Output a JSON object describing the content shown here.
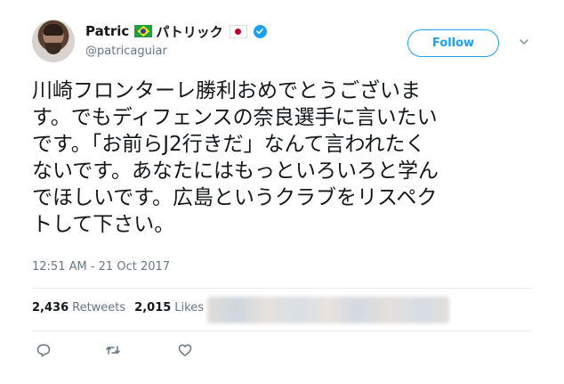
{
  "user": {
    "display_name": "Patric",
    "display_name_jp": "パトリック",
    "handle": "@patricaguiar",
    "flags": [
      "brazil-flag",
      "japan-flag"
    ],
    "verified": true
  },
  "follow_button": {
    "label": "Follow"
  },
  "tweet": {
    "lines": [
      "川崎フロンターレ勝利おめでとうございま",
      "す。でもディフェンスの奈良選手に言いたい",
      "です。「お前らJ2行きだ」なんて言われたく",
      "ないです。あなたにはもっといろいろと学ん",
      "でほしいです。広島というクラブをリスペク",
      "トして下さい。"
    ],
    "timestamp": "12:51 AM - 21 Oct 2017"
  },
  "stats": {
    "retweets_count": "2,436",
    "retweets_label": "Retweets",
    "likes_count": "2,015",
    "likes_label": "Likes"
  },
  "actions": {
    "icons": [
      "reply-icon",
      "retweet-icon",
      "like-icon"
    ]
  },
  "colors": {
    "accent": "#1da1f2",
    "text": "#14171a",
    "muted": "#657786",
    "divider": "#e6ecf0"
  }
}
